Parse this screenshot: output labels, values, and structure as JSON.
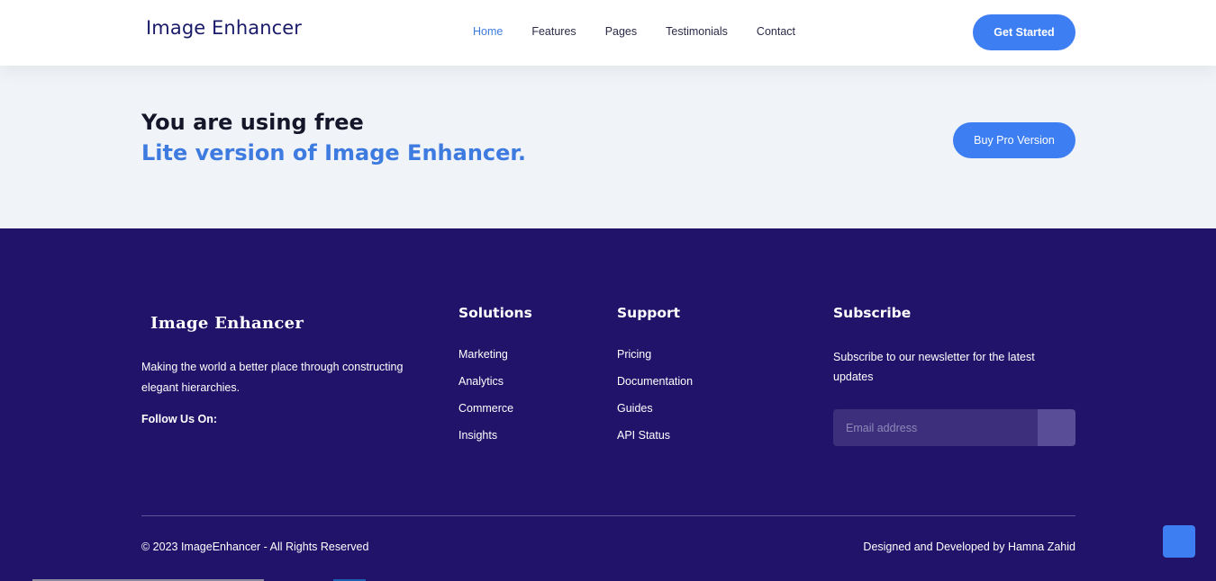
{
  "header": {
    "brand": "Image Enhancer",
    "nav": [
      {
        "label": "Home",
        "active": true
      },
      {
        "label": "Features",
        "active": false
      },
      {
        "label": "Pages",
        "active": false
      },
      {
        "label": "Testimonials",
        "active": false
      },
      {
        "label": "Contact",
        "active": false
      }
    ],
    "cta_label": "Get Started"
  },
  "banner": {
    "line1": "You are using free",
    "line2": "Lite version of Image Enhancer.",
    "button_label": "Buy Pro Version"
  },
  "footer": {
    "brand": "Image Enhancer",
    "description": "Making the world a better place through constructing elegant hierarchies.",
    "follow_label": "Follow Us On:",
    "solutions": {
      "title": "Solutions",
      "items": [
        "Marketing",
        "Analytics",
        "Commerce",
        "Insights"
      ]
    },
    "support": {
      "title": "Support",
      "items": [
        "Pricing",
        "Documentation",
        "Guides",
        "API Status"
      ]
    },
    "subscribe": {
      "title": "Subscribe",
      "text": "Subscribe to our newsletter for the latest updates",
      "email_placeholder": "Email address",
      "email_value": ""
    },
    "copyright": "© 2023 ImageEnhancer - All Rights Reserved",
    "credit": "Designed and Developed by Hamna Zahid"
  },
  "colors": {
    "accent": "#3d7ef2",
    "footer_bg": "#21126a",
    "banner_bg": "#f0f3f7",
    "brand_text": "#1a1a6b"
  },
  "icons": {
    "back_to_top": "arrow-up-icon"
  }
}
